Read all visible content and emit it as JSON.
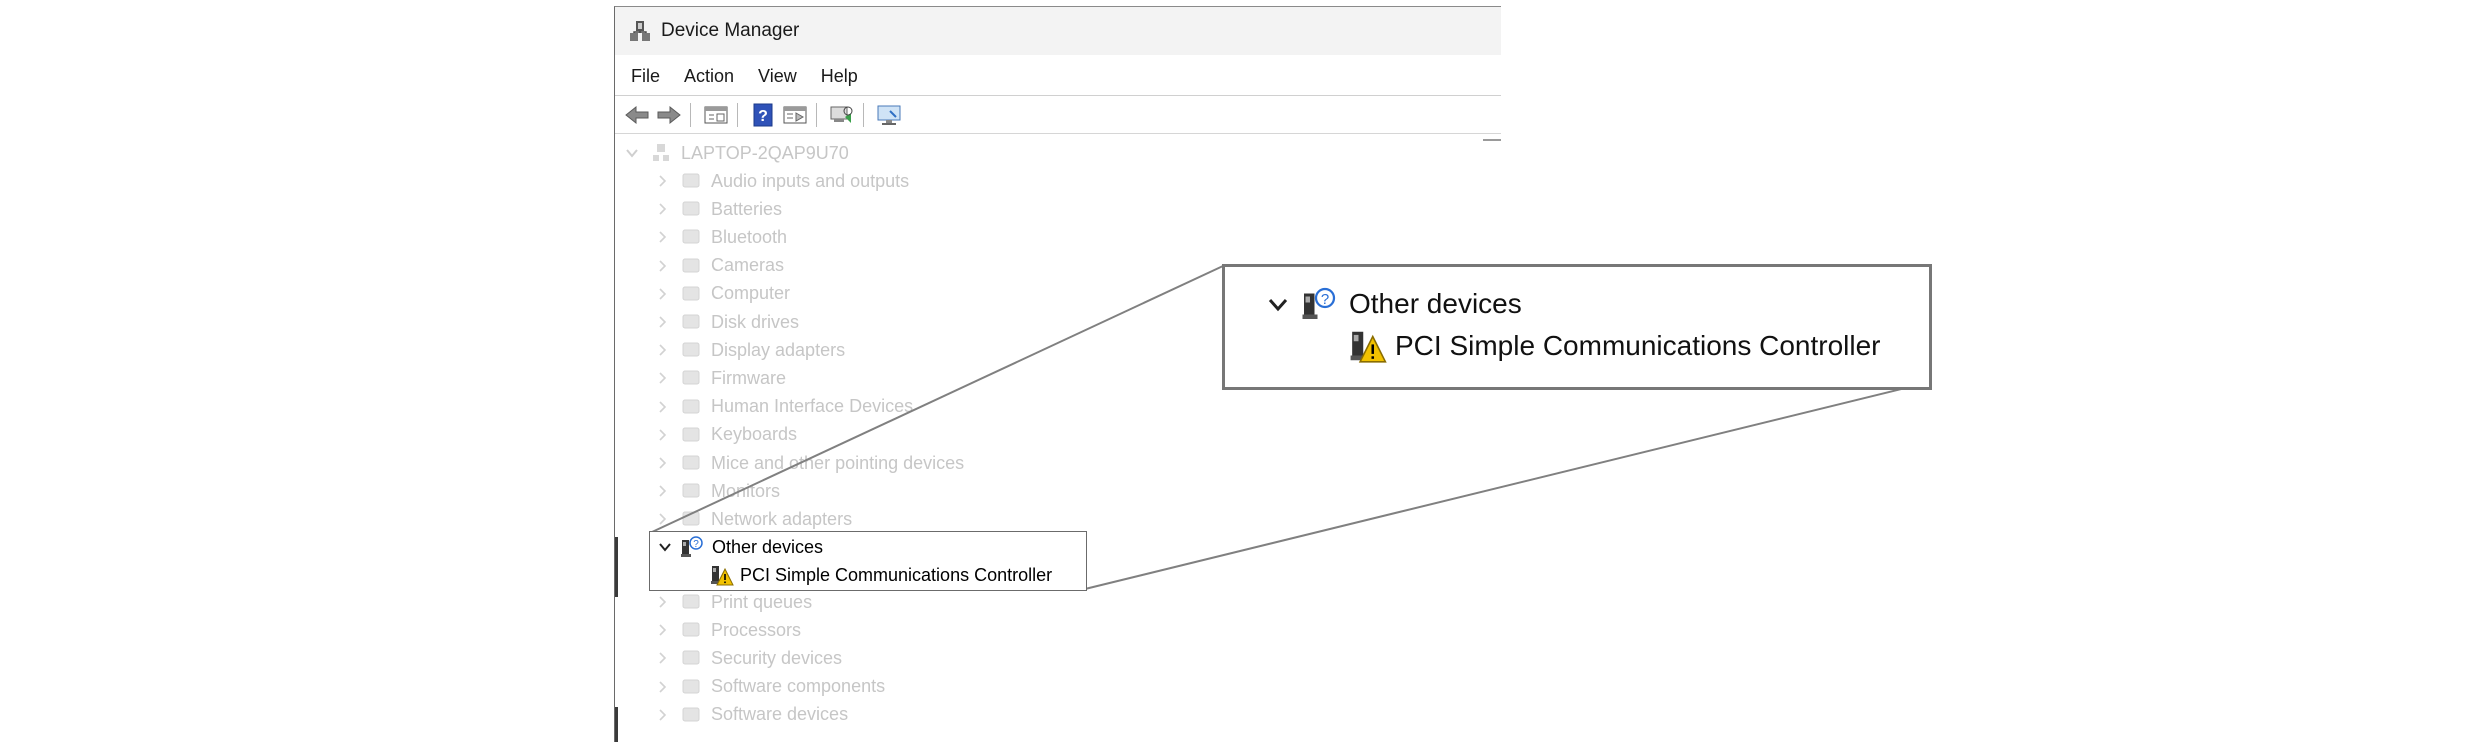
{
  "window": {
    "title": "Device Manager",
    "icon": "device-manager-icon"
  },
  "menu": [
    "File",
    "Action",
    "View",
    "Help"
  ],
  "toolbar": {
    "buttons": [
      "back-arrow-icon",
      "forward-arrow-icon",
      "properties-icon",
      "help-icon",
      "show-hide-tree-icon",
      "scan-hardware-icon",
      "monitor-icon"
    ]
  },
  "tree": {
    "root": "LAPTOP-2QAP9U70",
    "categories": [
      {
        "label": "Audio inputs and outputs",
        "icon": "speaker-icon"
      },
      {
        "label": "Batteries",
        "icon": "battery-icon"
      },
      {
        "label": "Bluetooth",
        "icon": "bluetooth-icon"
      },
      {
        "label": "Cameras",
        "icon": "camera-icon"
      },
      {
        "label": "Computer",
        "icon": "computer-icon"
      },
      {
        "label": "Disk drives",
        "icon": "disk-drive-icon"
      },
      {
        "label": "Display adapters",
        "icon": "display-adapter-icon"
      },
      {
        "label": "Firmware",
        "icon": "firmware-icon"
      },
      {
        "label": "Human Interface Devices",
        "icon": "hid-icon"
      },
      {
        "label": "Keyboards",
        "icon": "keyboard-icon"
      },
      {
        "label": "Mice and other pointing devices",
        "icon": "mouse-icon"
      },
      {
        "label": "Monitors",
        "icon": "monitor-icon"
      },
      {
        "label": "Network adapters",
        "icon": "network-adapter-icon"
      }
    ],
    "highlighted_group": {
      "label": "Other devices",
      "child": "PCI Simple Communications Controller"
    },
    "categories_after": [
      {
        "label": "Print queues",
        "icon": "printer-icon"
      },
      {
        "label": "Processors",
        "icon": "processor-icon"
      },
      {
        "label": "Security devices",
        "icon": "security-icon"
      },
      {
        "label": "Software components",
        "icon": "software-icon"
      },
      {
        "label": "Software devices",
        "icon": "software-device-icon"
      }
    ]
  },
  "zoom": {
    "group_label": "Other devices",
    "child_label": "PCI Simple Communications Controller"
  },
  "colors": {
    "faded_text": "#c6c6c6",
    "warning": "#f2c200",
    "question_blue": "#2a6fd6",
    "callout_border": "#777777"
  }
}
